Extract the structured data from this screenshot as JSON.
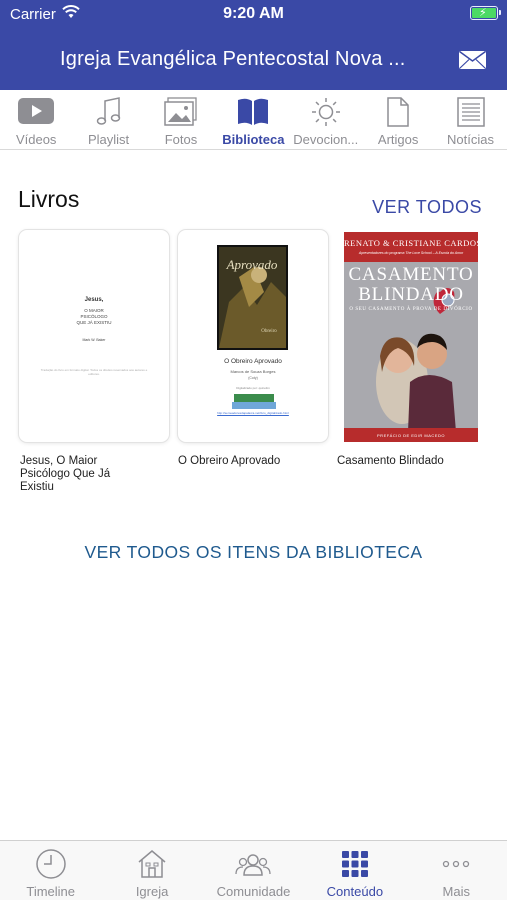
{
  "status_bar": {
    "carrier": "Carrier",
    "time": "9:20 AM",
    "battery_charging": true
  },
  "header": {
    "title": "Igreja Evangélica Pentecostal Nova ...",
    "mail_icon": "envelope-icon"
  },
  "top_tabs": [
    {
      "label": "Vídeos",
      "icon": "play-icon",
      "active": false
    },
    {
      "label": "Playlist",
      "icon": "music-note-icon",
      "active": false
    },
    {
      "label": "Fotos",
      "icon": "photos-icon",
      "active": false
    },
    {
      "label": "Biblioteca",
      "icon": "book-icon",
      "active": true
    },
    {
      "label": "Devocion...",
      "icon": "sun-icon",
      "active": false
    },
    {
      "label": "Artigos",
      "icon": "document-icon",
      "active": false
    },
    {
      "label": "Notícias",
      "icon": "newspaper-icon",
      "active": false
    }
  ],
  "section": {
    "title": "Livros",
    "see_all": "VER TODOS",
    "books": [
      {
        "title": "Jesus, O Maior Psicólogo Que Já Existiu",
        "cover": {
          "heading": "Jesus,",
          "lines": "O MAIOR\nPSICÓLOGO\nQUE JÁ EXISTIU",
          "author": "Mark W. Baker",
          "note": "Tradução do livro em formato digital. Todos os direitos reservados aos autores e editores."
        }
      },
      {
        "title": "O Obreiro Aprovado",
        "cover": {
          "caption": "O Obreiro Aprovado",
          "author": "Marcos de Souza Borges",
          "nickname": "(Coty)",
          "digitized": "Digitalizado por: quinolim",
          "url": "http://semeadoresdapalavra.net/livro_digitalizado.html"
        }
      },
      {
        "title": "Casamento Blindado",
        "cover": {
          "authors": "RENATO & CRISTIANE CARDOSO",
          "subtitle": "Apresentadores do programa The Love School – A Escola do Amor",
          "line1": "CASAMENTO",
          "line2": "BLINDADO",
          "tagline": "O SEU CASAMENTO À PROVA DE DIVÓRCIO",
          "footer": "PREFÁCIO DE EDIR MACEDO"
        }
      }
    ],
    "see_library": "VER TODOS OS ITENS DA BIBLIOTECA"
  },
  "bottom_tabs": [
    {
      "label": "Timeline",
      "icon": "clock-icon",
      "active": false
    },
    {
      "label": "Igreja",
      "icon": "church-icon",
      "active": false
    },
    {
      "label": "Comunidade",
      "icon": "people-icon",
      "active": false
    },
    {
      "label": "Conteúdo",
      "icon": "grid-icon",
      "active": true
    },
    {
      "label": "Mais",
      "icon": "more-icon",
      "active": false
    }
  ],
  "colors": {
    "primary": "#3a49a6",
    "link": "#1f5a8e",
    "inactive": "#8e8e93"
  }
}
